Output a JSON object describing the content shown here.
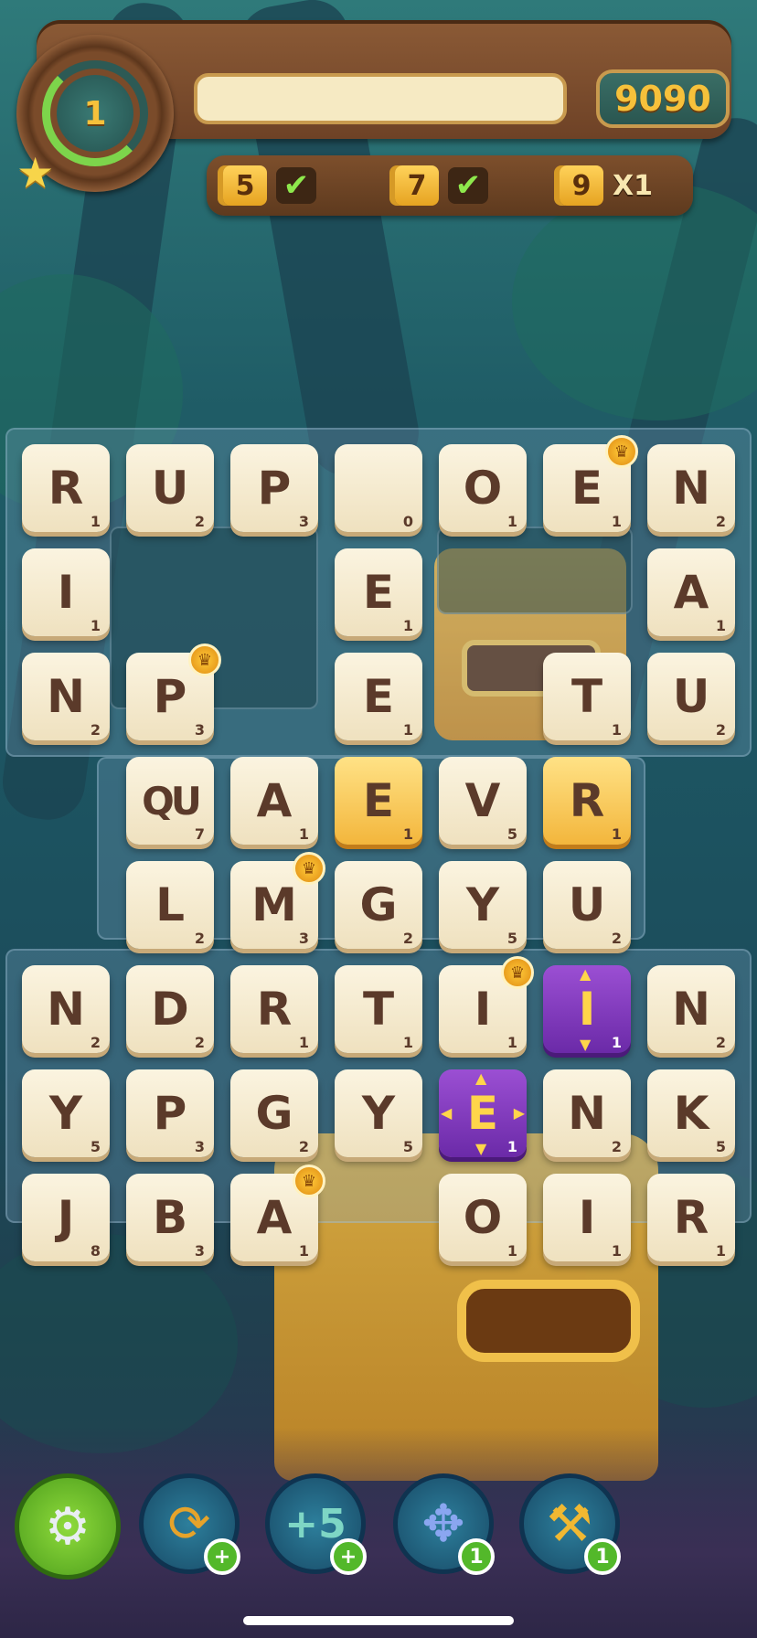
{
  "hud": {
    "level": "1",
    "score": "9090",
    "goals": [
      {
        "length": "5",
        "status": "✔"
      },
      {
        "length": "7",
        "status": "✔"
      },
      {
        "length": "9",
        "status": "X1"
      }
    ]
  },
  "board": {
    "tiles": [
      {
        "l": "R",
        "p": "1"
      },
      {
        "l": "U",
        "p": "2"
      },
      {
        "l": "P",
        "p": "3"
      },
      {
        "l": "",
        "p": "0"
      },
      {
        "l": "O",
        "p": "1"
      },
      {
        "l": "E",
        "p": "1"
      },
      {
        "l": "N",
        "p": "2"
      },
      {
        "l": "I",
        "p": "1"
      },
      {
        "l": "E",
        "p": "1"
      },
      {
        "l": "A",
        "p": "1"
      },
      {
        "l": "N",
        "p": "2"
      },
      {
        "l": "P",
        "p": "3"
      },
      {
        "l": "E",
        "p": "1"
      },
      {
        "l": "T",
        "p": "1"
      },
      {
        "l": "U",
        "p": "2"
      },
      {
        "l": "QU",
        "p": "7"
      },
      {
        "l": "A",
        "p": "1"
      },
      {
        "l": "E",
        "p": "1"
      },
      {
        "l": "V",
        "p": "5"
      },
      {
        "l": "R",
        "p": "1"
      },
      {
        "l": "L",
        "p": "2"
      },
      {
        "l": "M",
        "p": "3"
      },
      {
        "l": "G",
        "p": "2"
      },
      {
        "l": "Y",
        "p": "5"
      },
      {
        "l": "U",
        "p": "2"
      },
      {
        "l": "N",
        "p": "2"
      },
      {
        "l": "D",
        "p": "2"
      },
      {
        "l": "R",
        "p": "1"
      },
      {
        "l": "T",
        "p": "1"
      },
      {
        "l": "I",
        "p": "1"
      },
      {
        "l": "I",
        "p": "1"
      },
      {
        "l": "N",
        "p": "2"
      },
      {
        "l": "Y",
        "p": "5"
      },
      {
        "l": "P",
        "p": "3"
      },
      {
        "l": "G",
        "p": "2"
      },
      {
        "l": "Y",
        "p": "5"
      },
      {
        "l": "E",
        "p": "1"
      },
      {
        "l": "N",
        "p": "2"
      },
      {
        "l": "K",
        "p": "5"
      },
      {
        "l": "J",
        "p": "8"
      },
      {
        "l": "B",
        "p": "3"
      },
      {
        "l": "A",
        "p": "1"
      },
      {
        "l": "O",
        "p": "1"
      },
      {
        "l": "I",
        "p": "1"
      },
      {
        "l": "R",
        "p": "1"
      }
    ]
  },
  "toolbar": {
    "items": [
      {
        "icon": "gear-icon"
      },
      {
        "icon": "shuffle-icon",
        "badge": "+"
      },
      {
        "icon": "plus-five-icon",
        "badge": "+"
      },
      {
        "icon": "move-tile-icon",
        "badge": "1"
      },
      {
        "icon": "hammer-icon",
        "badge": "1"
      }
    ]
  }
}
